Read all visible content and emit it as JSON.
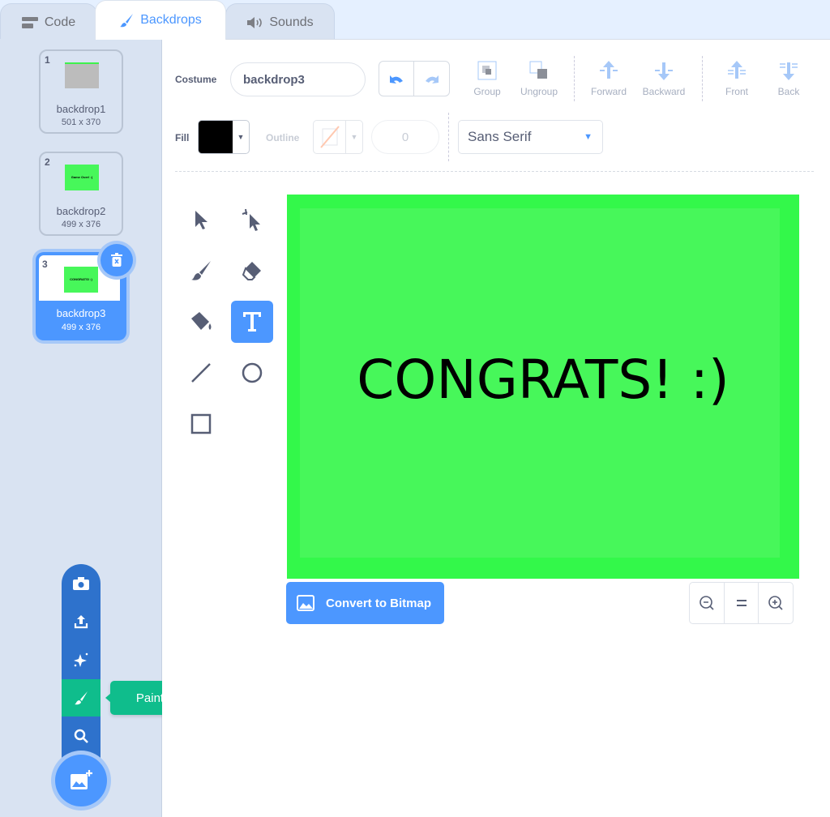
{
  "tabs": [
    {
      "label": "Code",
      "icon": "code-blocks-icon"
    },
    {
      "label": "Backdrops",
      "icon": "paintbrush-icon",
      "active": true
    },
    {
      "label": "Sounds",
      "icon": "speaker-icon"
    }
  ],
  "backdrops": [
    {
      "index": "1",
      "name": "backdrop1",
      "size": "501 x 370"
    },
    {
      "index": "2",
      "name": "backdrop2",
      "size": "499 x 376",
      "thumb_text": "Game Over! :("
    },
    {
      "index": "3",
      "name": "backdrop3",
      "size": "499 x 376",
      "thumb_text": "CONGRATS! :)",
      "selected": true
    }
  ],
  "editor": {
    "costume_label": "Costume",
    "costume_name": "backdrop3",
    "group": "Group",
    "ungroup": "Ungroup",
    "forward": "Forward",
    "backward": "Backward",
    "front": "Front",
    "back": "Back",
    "fill_label": "Fill",
    "fill_color": "#000000",
    "outline_label": "Outline",
    "outline_width": "0",
    "font": "Sans Serif",
    "canvas_text": "CONGRATS! :)",
    "canvas_color": "#47f75a",
    "convert_label": "Convert to Bitmap",
    "active_tool": "text"
  },
  "menu": {
    "tooltip": "Paint",
    "items": [
      "camera",
      "upload",
      "surprise",
      "paint",
      "search"
    ]
  },
  "colors": {
    "accent": "#4c97ff",
    "paint_green": "#0fbd8c"
  }
}
